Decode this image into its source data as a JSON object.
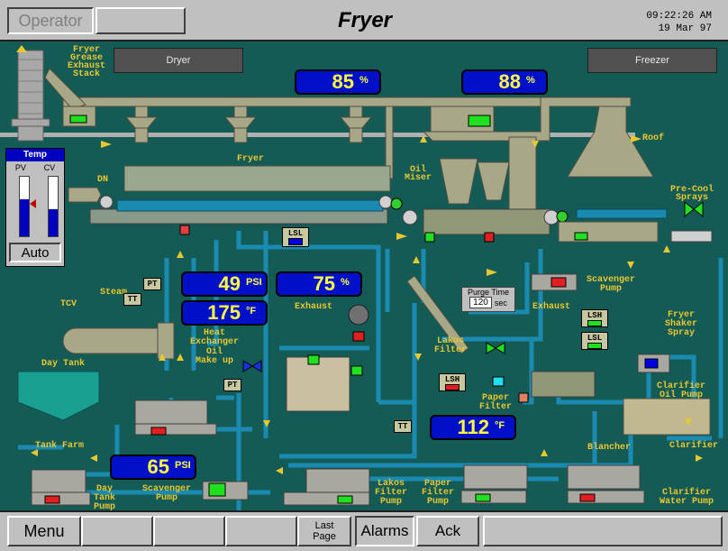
{
  "header": {
    "operator_label": "Operator",
    "blank_label": "",
    "title": "Fryer",
    "time": "09:22:26 AM",
    "date": "19 Mar 97"
  },
  "nav_panels": {
    "dryer": "Dryer",
    "freezer": "Freezer"
  },
  "readouts": {
    "exhaust_fan_1": {
      "value": "85",
      "unit": "%"
    },
    "exhaust_fan_2": {
      "value": "88",
      "unit": "%"
    },
    "steam_pressure": {
      "value": "49",
      "unit": "PSI"
    },
    "steam_temp": {
      "value": "175",
      "unit": "°F"
    },
    "exhaust_pct": {
      "value": "75",
      "unit": "%"
    },
    "oil_temp": {
      "value": "112",
      "unit": "°F"
    },
    "pump_pressure": {
      "value": "65",
      "unit": "PSI"
    }
  },
  "temp_panel": {
    "title": "Temp",
    "pv_label": "PV",
    "cv_label": "CV",
    "mode": "Auto",
    "pv_level": 0.62,
    "cv_level": 0.45
  },
  "purge": {
    "label": "Purge Time",
    "value": "120",
    "unit": "sec"
  },
  "tags": {
    "lsl": "LSL",
    "pt1": "PT",
    "tt1": "TT",
    "pt2": "PT",
    "tt2": "TT",
    "lsh1": "LSH",
    "lsl2": "LSL",
    "lsh2": "LSH"
  },
  "labels": {
    "fryer_stack": [
      "Fryer",
      "Grease",
      "Exhaust",
      "Stack"
    ],
    "roof": "Roof",
    "fryer": "Fryer",
    "dn": "DN",
    "oil_miser": [
      "Oil",
      "Miser"
    ],
    "precool": [
      "Pre-Cool",
      "Sprays"
    ],
    "steam": "Steam",
    "tcv": "TCV",
    "heat_exchanger": [
      "Heat",
      "Exchanger"
    ],
    "exhaust1": "Exhaust",
    "oil_makeup": [
      "Oil",
      "Make up"
    ],
    "day_tank": "Day Tank",
    "scavenger_pump_r": [
      "Scavenger",
      "Pump"
    ],
    "exhaust2": "Exhaust",
    "fryer_shaker": [
      "Fryer",
      "Shaker",
      "Spray"
    ],
    "lakos_filter": [
      "Lakos",
      "Filter"
    ],
    "paper_filter": [
      "Paper",
      "Filter"
    ],
    "clarifier_oil_pump": [
      "Clarifier",
      "Oil Pump"
    ],
    "tank_farm": "Tank Farm",
    "blancher": "Blancher",
    "clarifier": "Clarifier",
    "day_tank_pump": [
      "Day",
      "Tank",
      "Pump"
    ],
    "scavenger_pump_b": [
      "Scavenger",
      "Pump"
    ],
    "lakos_filter_pump": [
      "Lakos",
      "Filter",
      "Pump"
    ],
    "paper_filter_pump": [
      "Paper",
      "Filter",
      "Pump"
    ],
    "clarifier_water_pump": [
      "Clarifier",
      "Water Pump"
    ]
  },
  "footer": {
    "menu": "Menu",
    "b2": "",
    "b3": "",
    "b4": "",
    "last_page": [
      "Last",
      "Page"
    ],
    "alarms": "Alarms",
    "ack": "Ack",
    "b8": ""
  },
  "colors": {
    "background": "#145a55",
    "pipe": "#1a8ab0",
    "equipment": "#a8a888",
    "readout_bg": "#0010c8",
    "readout_text": "#ffff40",
    "label": "#e8c830",
    "run_green": "#20e020",
    "stop_red": "#e02020"
  }
}
